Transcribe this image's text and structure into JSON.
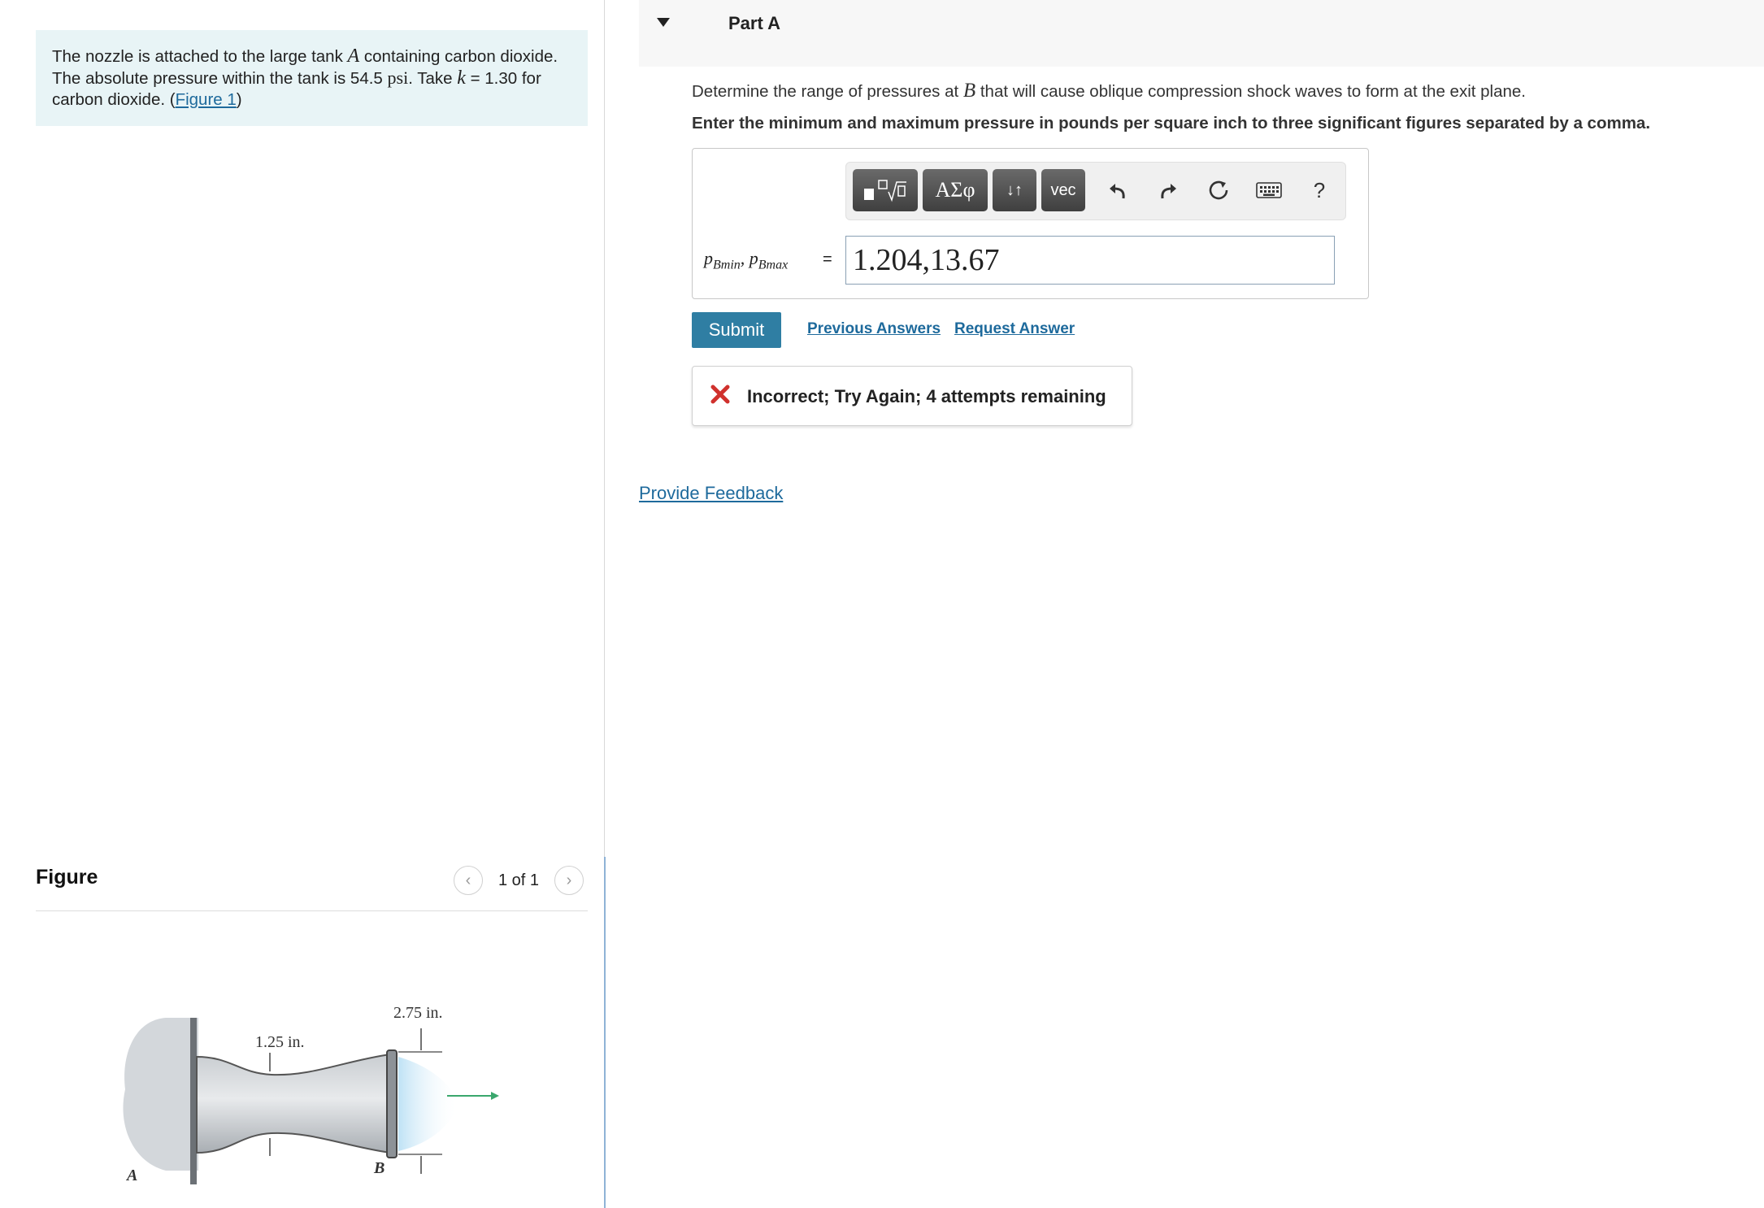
{
  "problem": {
    "text_1": "The nozzle is attached to the large tank ",
    "var_A": "A",
    "text_2": " containing carbon dioxide. The absolute pressure within the tank is 54.5 ",
    "unit_psi": "psi",
    "text_3": ". Take ",
    "var_k": "k",
    "text_4": " = 1.30 for carbon dioxide. (",
    "figure_link": "Figure 1",
    "text_5": ")"
  },
  "figure": {
    "heading": "Figure",
    "pager": "1 of 1",
    "labels": {
      "throat_dim": "1.25 in.",
      "exit_dim": "2.75 in.",
      "tank": "A",
      "exit": "B"
    }
  },
  "part": {
    "title": "Part A",
    "question_1": "Determine the range of pressures at ",
    "question_var": "B",
    "question_2": " that will cause oblique compression shock waves to form at the exit plane.",
    "instruction": "Enter the minimum and maximum pressure in pounds per square inch to three significant figures separated by a comma."
  },
  "toolbar": {
    "greek_label": "ΑΣφ",
    "sub_label": "↓↑",
    "vec_label": "vec",
    "icons": [
      "templates-icon",
      "greek-icon",
      "subscript-icon",
      "vec-icon",
      "undo-icon",
      "redo-icon",
      "reset-icon",
      "keyboard-icon",
      "help-icon"
    ],
    "help_label": "?"
  },
  "answer": {
    "label_p": "p",
    "label_sub_min": "Bmin",
    "label_sep": ", ",
    "label_sub_max": "Bmax",
    "equals": "=",
    "value": "1.204,13.67"
  },
  "actions": {
    "submit": "Submit",
    "previous_answers": "Previous Answers",
    "request_answer": "Request Answer"
  },
  "feedback": {
    "message": "Incorrect; Try Again; 4 attempts remaining",
    "status_color": "#d0312d"
  },
  "provide_feedback": "Provide Feedback"
}
